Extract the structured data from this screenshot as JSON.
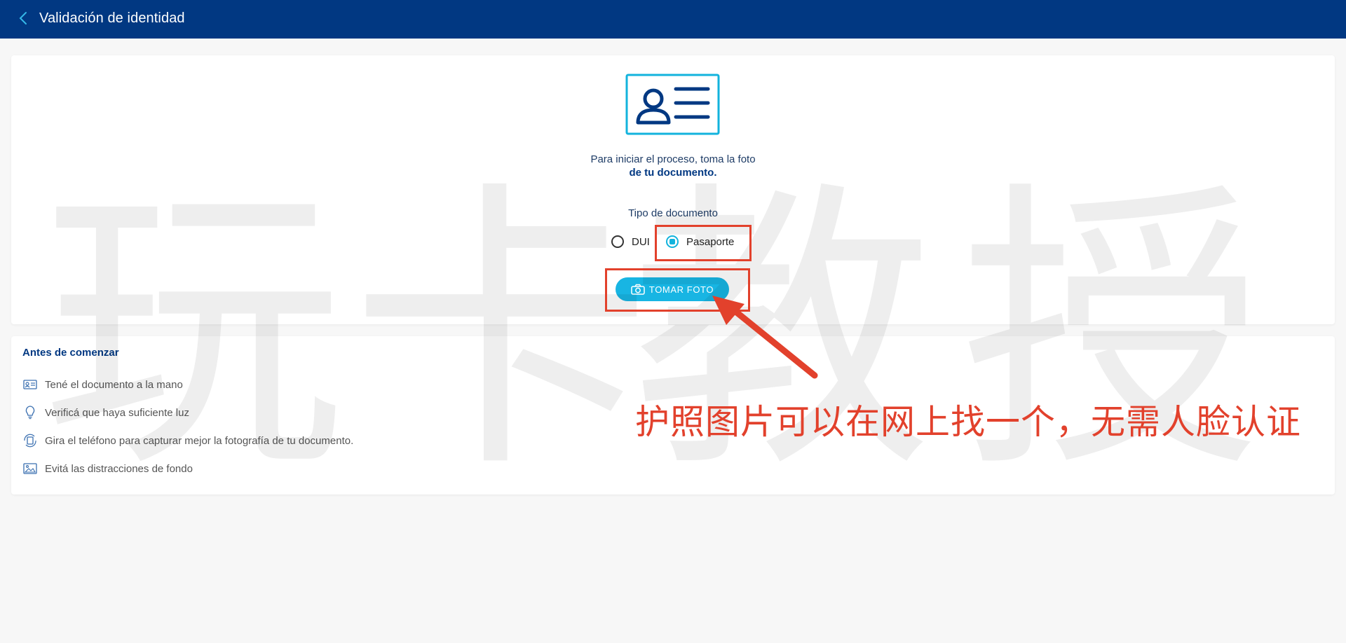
{
  "header": {
    "title": "Validación de identidad",
    "back_icon": "chevron-left-icon",
    "background": "#013882"
  },
  "main": {
    "icon": "id-card-icon",
    "intro_line1": "Para iniciar el proceso, toma la foto",
    "intro_line2": "de tu documento.",
    "doc_type_label": "Tipo de documento",
    "options": [
      {
        "label": "DUI",
        "selected": false
      },
      {
        "label": "Pasaporte",
        "selected": true
      }
    ],
    "take_photo_label": "TOMAR FOTO",
    "accent": "#18b5e3"
  },
  "tips": {
    "title": "Antes de comenzar",
    "items": [
      {
        "icon": "id-card-small-icon",
        "text": "Tené el documento a la mano"
      },
      {
        "icon": "lightbulb-icon",
        "text": "Verificá que haya suficiente luz"
      },
      {
        "icon": "rotate-phone-icon",
        "text": "Gira el teléfono para capturar mejor la fotografía de tu documento."
      },
      {
        "icon": "picture-icon",
        "text": "Evitá las distracciones de fondo"
      }
    ]
  },
  "watermark": {
    "chars": [
      "玩",
      "卡",
      "教",
      "授"
    ]
  },
  "annotation": {
    "text": "护照图片可以在网上找一个，无需人脸认证",
    "color": "#e2412c"
  }
}
